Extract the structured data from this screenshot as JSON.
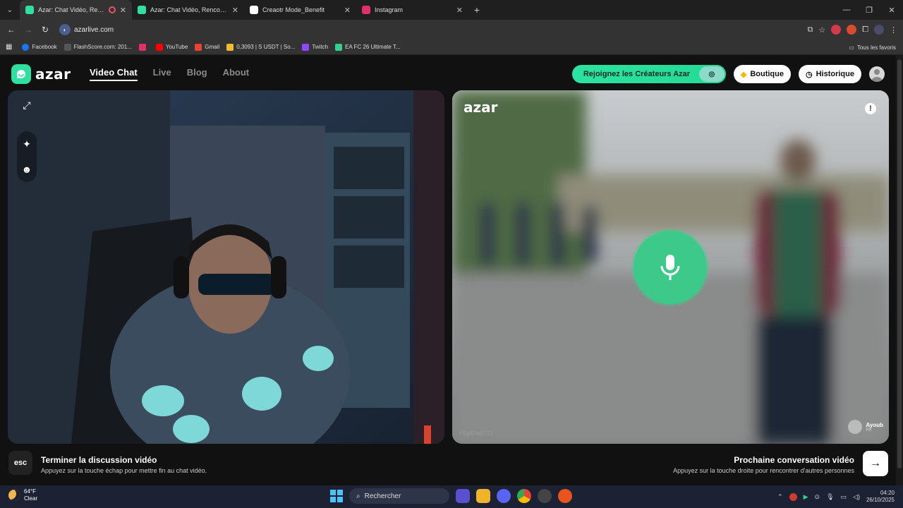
{
  "browser": {
    "tabs": [
      {
        "title": "Azar: Chat Vidéo, Rencontr",
        "active": true,
        "favicon_color": "#2fe0a0",
        "recording": true
      },
      {
        "title": "Azar: Chat Vidéo, Rencontrer d",
        "active": false,
        "favicon_color": "#2fe0a0"
      },
      {
        "title": "Creaotr Mode_Benefit",
        "active": false,
        "favicon_color": "#ffffff"
      },
      {
        "title": "Instagram",
        "active": false,
        "favicon_color": "#e1306c"
      }
    ],
    "url": "azarlive.com",
    "bookmarks": [
      {
        "label": "Facebook",
        "color": "#1877f2"
      },
      {
        "label": "FlashScore.com: 201...",
        "color": "#333333"
      },
      {
        "label": "",
        "color": "#e1306c"
      },
      {
        "label": "YouTube",
        "color": "#ff0000"
      },
      {
        "label": "Gmail",
        "color": "#ea4335"
      },
      {
        "label": "0,3093 | S USDT | So...",
        "color": "#f3ba2f"
      },
      {
        "label": "Twitch",
        "color": "#9146ff"
      },
      {
        "label": "EA FC 26 Ultimate T...",
        "color": "#2fd28f"
      }
    ],
    "bookmarks_right": "Tous les favoris"
  },
  "site": {
    "logo_text": "azar",
    "nav": [
      {
        "label": "Video Chat",
        "active": true
      },
      {
        "label": "Live",
        "active": false
      },
      {
        "label": "Blog",
        "active": false
      },
      {
        "label": "About",
        "active": false
      }
    ],
    "creators_button": "Rejoignez les Créateurs Azar",
    "shop_button": "Boutique",
    "history_button": "Historique"
  },
  "video": {
    "remote_watermark": "azar",
    "report_icon": "!",
    "session_id": "F5gA7eQ7I1",
    "peer_name": "Ayoub",
    "peer_country": "FR"
  },
  "footer": {
    "esc_label": "esc",
    "end_title": "Terminer la discussion vidéo",
    "end_sub": "Appuyez sur la touche échap pour mettre fin au chat vidéo.",
    "next_title": "Prochaine conversation vidéo",
    "next_sub": "Appuyez sur la touche droite pour rencontrer d'autres personnes"
  },
  "taskbar": {
    "temp": "64°F",
    "weather": "Clear",
    "search_placeholder": "Rechercher",
    "time": "04:20",
    "date": "26/10/2025"
  }
}
